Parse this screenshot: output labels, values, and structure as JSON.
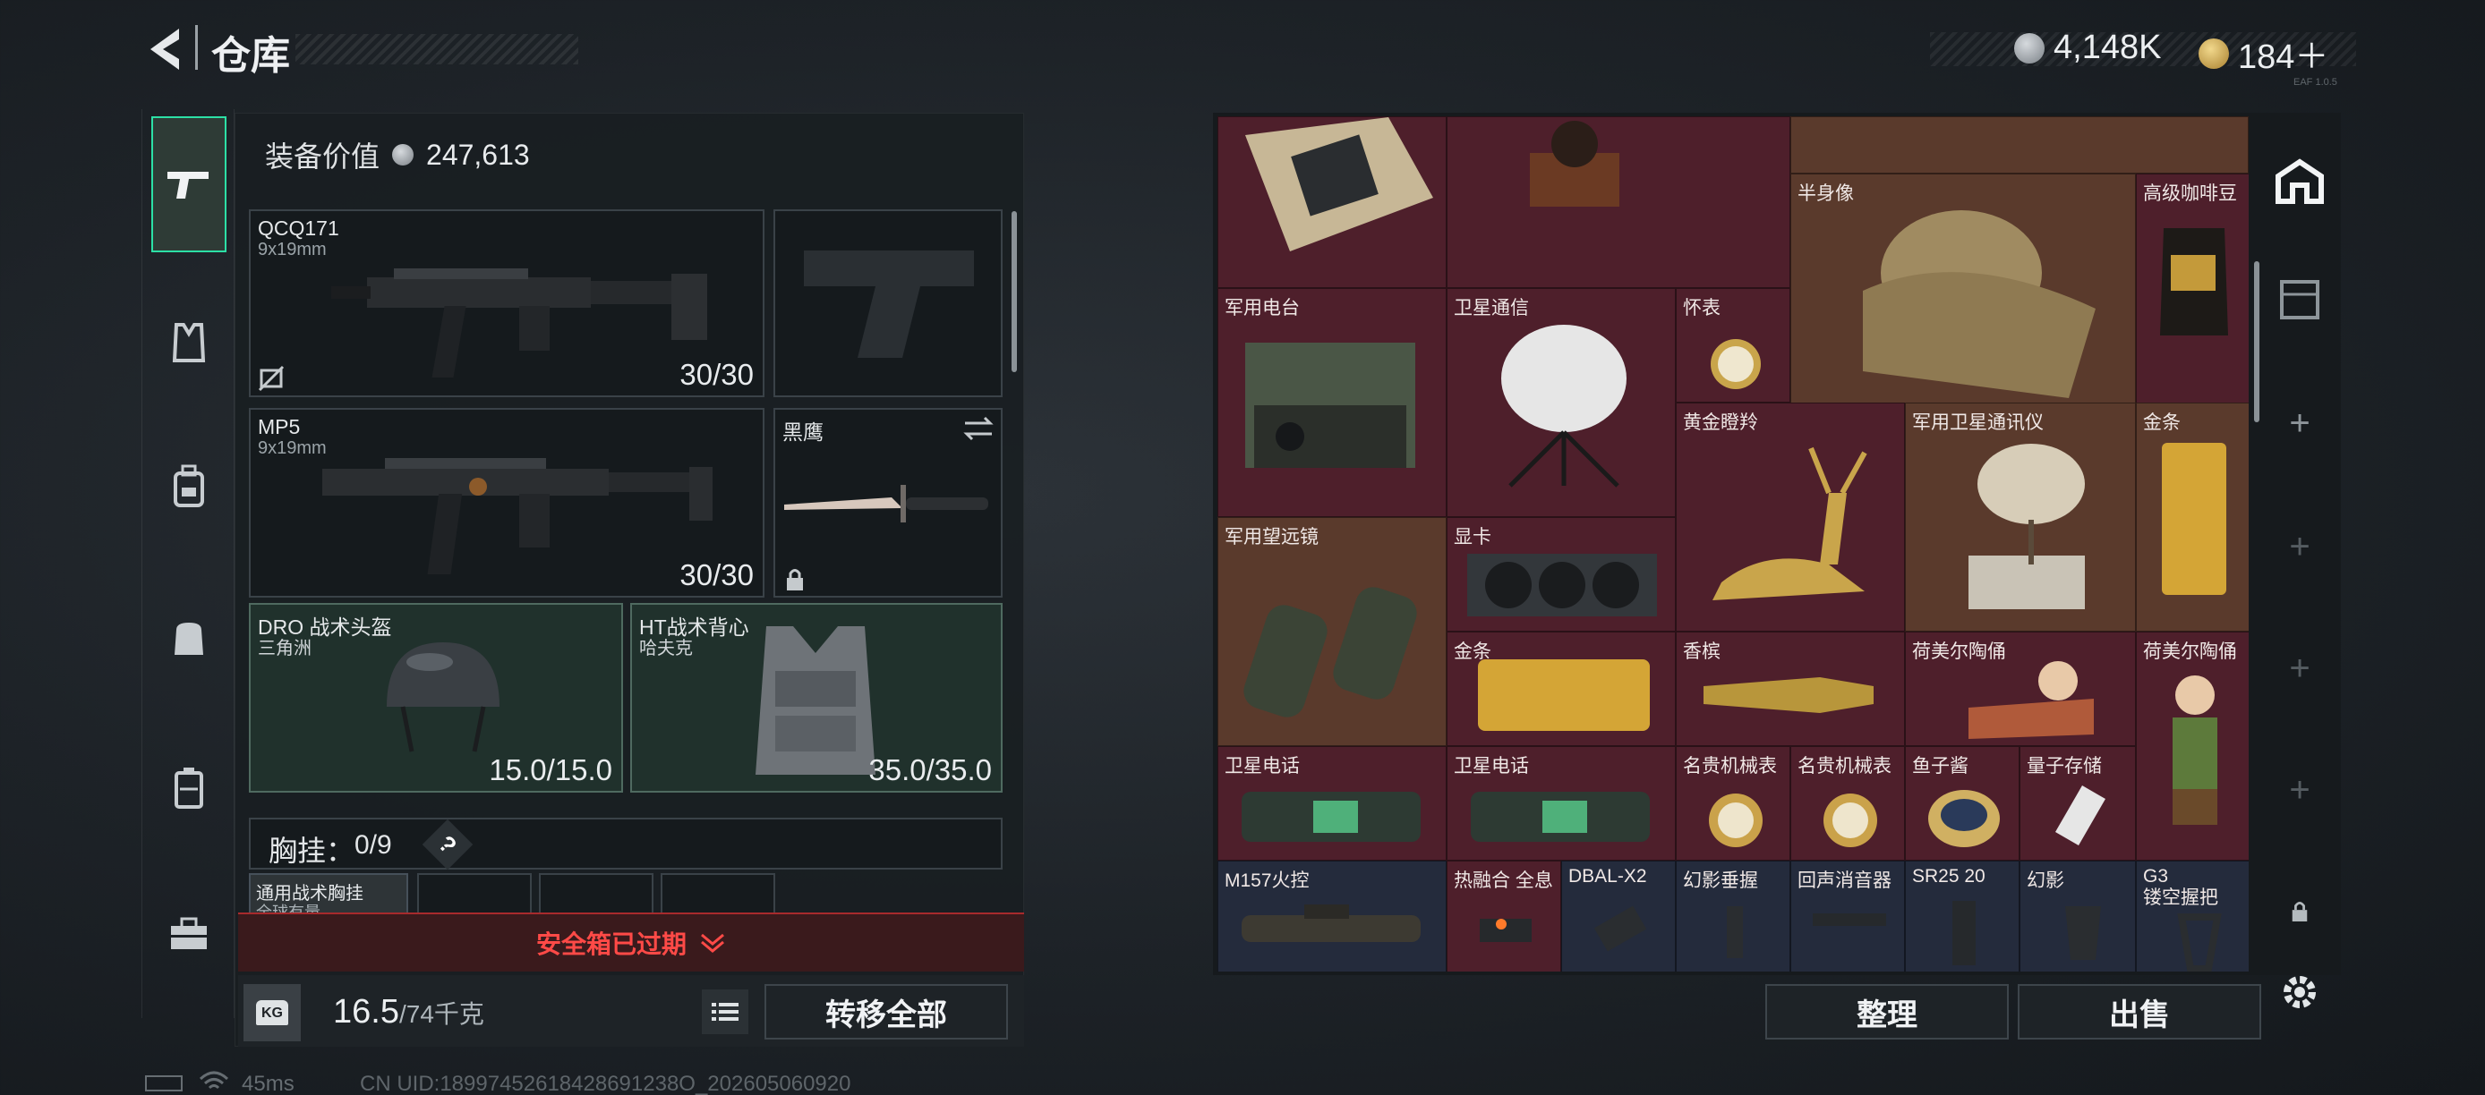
{
  "header": {
    "title": "仓库",
    "currency1": "4,148K",
    "currency2": "184＋",
    "version_tag": "EAF 1.0.5"
  },
  "left": {
    "equip_value_label": "装备价值",
    "equip_value": "247,613",
    "primary1": {
      "name": "QCQ171",
      "caliber": "9x19mm",
      "ammo": "30/30"
    },
    "primary2": {
      "name": "MP5",
      "caliber": "9x19mm",
      "ammo": "30/30"
    },
    "melee": {
      "name": "黑鹰"
    },
    "helmet": {
      "name": "DRO 战术头盔",
      "sub": "三角洲",
      "durability": "15.0/15.0"
    },
    "armor": {
      "name": "HT战术背心",
      "sub": "哈夫克",
      "durability": "35.0/35.0"
    },
    "rig": {
      "label": "胸挂：",
      "count": "0/9",
      "help": "?",
      "item_name": "通用战术胸挂",
      "item_sub": "全球有量"
    },
    "safebox_expired": "安全箱已过期",
    "weight": {
      "value": "16.5",
      "max": "/74千克",
      "icon_label": "KG"
    },
    "transfer_all": "转移全部"
  },
  "stash": {
    "items": [
      {
        "id": "bust",
        "label": "半身像"
      },
      {
        "id": "coffee",
        "label": "高级咖啡豆"
      },
      {
        "id": "radio",
        "label": "军用电台"
      },
      {
        "id": "sat",
        "label": "卫星通信"
      },
      {
        "id": "watch",
        "label": "怀表"
      },
      {
        "id": "deer",
        "label": "黄金瞪羚"
      },
      {
        "id": "satcom",
        "label": "军用卫星通讯仪"
      },
      {
        "id": "gold1",
        "label": "金条"
      },
      {
        "id": "binoc",
        "label": "军用望远镜"
      },
      {
        "id": "gpu",
        "label": "显卡"
      },
      {
        "id": "gold2",
        "label": "金条"
      },
      {
        "id": "champagne",
        "label": "香槟"
      },
      {
        "id": "hummel1",
        "label": "荷美尔陶俑"
      },
      {
        "id": "hummel2",
        "label": "荷美尔陶俑"
      },
      {
        "id": "phone1",
        "label": "卫星电话"
      },
      {
        "id": "phone2",
        "label": "卫星电话"
      },
      {
        "id": "mwatch1",
        "label": "名贵机械表"
      },
      {
        "id": "mwatch2",
        "label": "名贵机械表"
      },
      {
        "id": "caviar",
        "label": "鱼子酱"
      },
      {
        "id": "usb",
        "label": "量子存储"
      },
      {
        "id": "scope",
        "label": "M157火控"
      },
      {
        "id": "thermal",
        "label": "热融合 全息"
      },
      {
        "id": "dbal",
        "label": "DBAL-X2"
      },
      {
        "id": "grip",
        "label": "幻影垂握"
      },
      {
        "id": "muzzle",
        "label": "回声消音器"
      },
      {
        "id": "mag",
        "label": "SR25 20"
      },
      {
        "id": "grip2",
        "label": "幻影"
      },
      {
        "id": "g3",
        "label": "G3\n镂空握把"
      }
    ],
    "sort_button": "整理",
    "sell_button": "出售"
  },
  "status": {
    "ping": "45ms",
    "uid": "CN UID:18997452618428691238O_202605060920"
  },
  "colors": {
    "cell_red": "#4e1f2b",
    "cell_blue": "#242b3c",
    "alert": "#e33a3a",
    "rig_green": "#20312c"
  }
}
